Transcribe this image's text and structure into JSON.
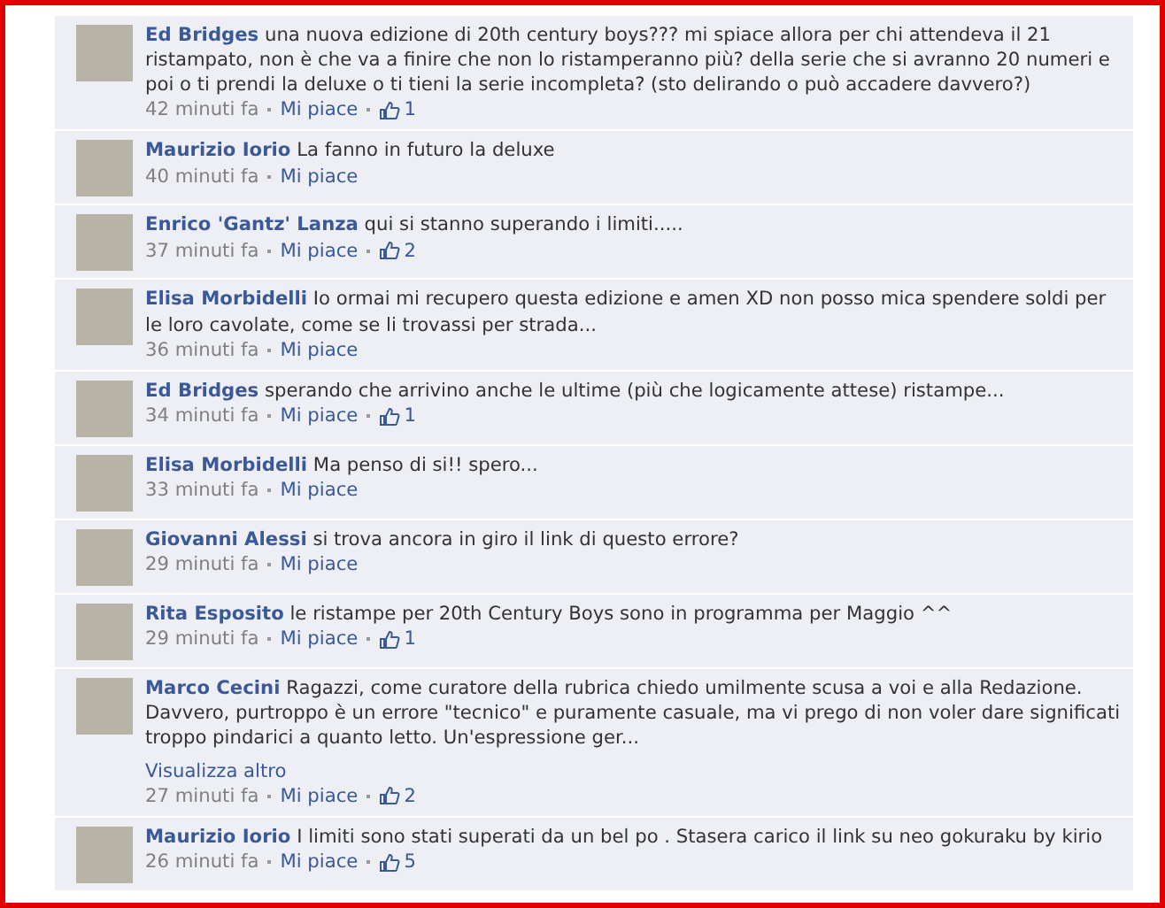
{
  "comments": [
    {
      "author": "Ed Bridges",
      "text": "una nuova edizione di 20th century boys??? mi spiace allora per chi attendeva il 21 ristampato, non è che va a finire che non lo ristamperanno più? della serie che si avranno 20 numeri e poi o ti prendi la deluxe o ti tieni la serie incompleta? (sto delirando o può accadere davvero?)",
      "time": "42 minuti fa",
      "like_link": "Mi piace",
      "likes": "1"
    },
    {
      "author": "Maurizio Iorio",
      "text": "La fanno in futuro la deluxe",
      "time": "40 minuti fa",
      "like_link": "Mi piace"
    },
    {
      "author": "Enrico 'Gantz' Lanza",
      "text": "qui si stanno superando i limiti.....",
      "time": "37 minuti fa",
      "like_link": "Mi piace",
      "likes": "2"
    },
    {
      "author": "Elisa Morbidelli",
      "text": "Io ormai mi recupero questa edizione e amen XD non posso mica spendere soldi per le loro cavolate, come se li trovassi per strada...",
      "time": "36 minuti fa",
      "like_link": "Mi piace"
    },
    {
      "author": "Ed Bridges",
      "text": "sperando che arrivino anche le ultime (più che logicamente attese) ristampe...",
      "time": "34 minuti fa",
      "like_link": "Mi piace",
      "likes": "1"
    },
    {
      "author": "Elisa Morbidelli",
      "text": "Ma penso di si!! spero...",
      "time": "33 minuti fa",
      "like_link": "Mi piace"
    },
    {
      "author": "Giovanni Alessi",
      "text": "si trova ancora in giro il link di questo errore?",
      "time": "29 minuti fa",
      "like_link": "Mi piace"
    },
    {
      "author": "Rita Esposito",
      "text": "le ristampe per 20th Century Boys sono in programma per Maggio ^^",
      "time": "29 minuti fa",
      "like_link": "Mi piace",
      "likes": "1"
    },
    {
      "author": "Marco Cecini",
      "text": "Ragazzi, come curatore della rubrica chiedo umilmente scusa a voi e alla Redazione. Davvero, purtroppo è un errore \"tecnico\" e puramente casuale, ma vi prego di non voler dare significati troppo pindarici a quanto letto. Un'espressione ger...",
      "see_more": "Visualizza altro",
      "time": "27 minuti fa",
      "like_link": "Mi piace",
      "likes": "2"
    },
    {
      "author": "Maurizio Iorio",
      "text": "I limiti sono stati superati da un bel po . Stasera carico il link su neo gokuraku by kirio",
      "time": "26 minuti fa",
      "like_link": "Mi piace",
      "likes": "5"
    }
  ]
}
